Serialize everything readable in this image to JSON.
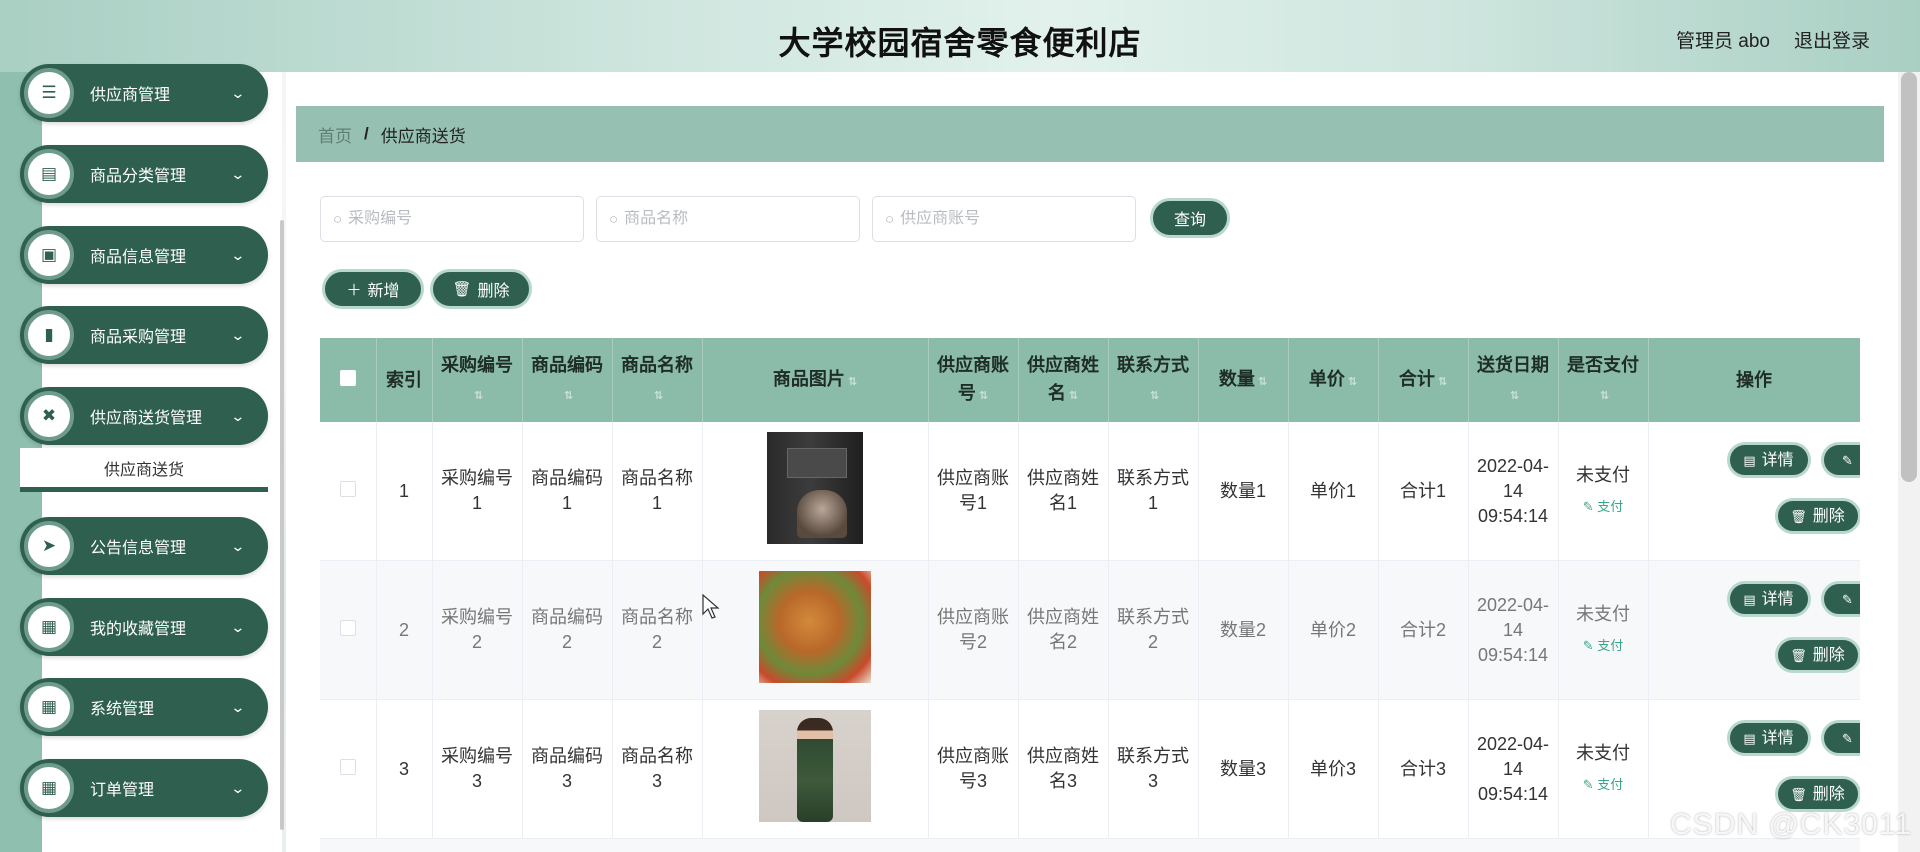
{
  "header": {
    "title": "大学校园宿舍零食便利店",
    "user": "管理员 abo",
    "logout": "退出登录"
  },
  "sidebar": {
    "items": [
      {
        "label": "供应商管理",
        "icon": "sliders-icon"
      },
      {
        "label": "商品分类管理",
        "icon": "clipboard-icon"
      },
      {
        "label": "商品信息管理",
        "icon": "briefcase-icon"
      },
      {
        "label": "商品采购管理",
        "icon": "book-icon"
      },
      {
        "label": "供应商送货管理",
        "icon": "film-icon"
      },
      {
        "label": "公告信息管理",
        "icon": "send-icon"
      },
      {
        "label": "我的收藏管理",
        "icon": "grid-icon"
      },
      {
        "label": "系统管理",
        "icon": "grid-icon"
      },
      {
        "label": "订单管理",
        "icon": "grid-icon"
      }
    ],
    "submenu": {
      "label": "供应商送货"
    }
  },
  "breadcrumb": {
    "home": "首页",
    "separator": "/",
    "current": "供应商送货"
  },
  "search": {
    "purchase_no_placeholder": "采购编号",
    "product_name_placeholder": "商品名称",
    "supplier_account_placeholder": "供应商账号",
    "query_label": "查询"
  },
  "actions": {
    "add_label": "新增",
    "delete_label": "删除"
  },
  "table": {
    "columns": {
      "index": "索引",
      "purchase_no": "采购编号",
      "product_no": "商品编码",
      "product_name": "商品名称",
      "product_image": "商品图片",
      "supplier_account": "供应商账号",
      "supplier_name": "供应商姓名",
      "contact": "联系方式",
      "quantity": "数量",
      "unit_price": "单价",
      "total": "合计",
      "delivery_date": "送货日期",
      "paid": "是否支付",
      "operation": "操作"
    },
    "rows": [
      {
        "index": "1",
        "purchase_no": "采购编号1",
        "product_no": "商品编码1",
        "product_name": "商品名称1",
        "image": "book-cover",
        "supplier_account": "供应商账号1",
        "supplier_name": "供应商姓名1",
        "contact": "联系方式1",
        "quantity": "数量1",
        "unit_price": "单价1",
        "total": "合计1",
        "delivery_date": "2022-04-14 09:54:14",
        "paid": "未支付",
        "pay": "支付",
        "detail": "详情",
        "delete": "删除"
      },
      {
        "index": "2",
        "purchase_no": "采购编号2",
        "product_no": "商品编码2",
        "product_name": "商品名称2",
        "image": "food",
        "supplier_account": "供应商账号2",
        "supplier_name": "供应商姓名2",
        "contact": "联系方式2",
        "quantity": "数量2",
        "unit_price": "单价2",
        "total": "合计2",
        "delivery_date": "2022-04-14 09:54:14",
        "paid": "未支付",
        "pay": "支付",
        "detail": "详情",
        "delete": "删除"
      },
      {
        "index": "3",
        "purchase_no": "采购编号3",
        "product_no": "商品编码3",
        "product_name": "商品名称3",
        "image": "dress",
        "supplier_account": "供应商账号3",
        "supplier_name": "供应商姓名3",
        "contact": "联系方式3",
        "quantity": "数量3",
        "unit_price": "单价3",
        "total": "合计3",
        "delivery_date": "2022-04-14 09:54:14",
        "paid": "未支付",
        "pay": "支付",
        "detail": "详情",
        "delete": "删除"
      }
    ]
  },
  "watermark": "CSDN @CK3011",
  "colors": {
    "primary": "#2f5f4e",
    "header_row": "#8bbcaa",
    "breadcrumb_bg": "#96c0b2",
    "pay_link": "#3aa58a"
  }
}
